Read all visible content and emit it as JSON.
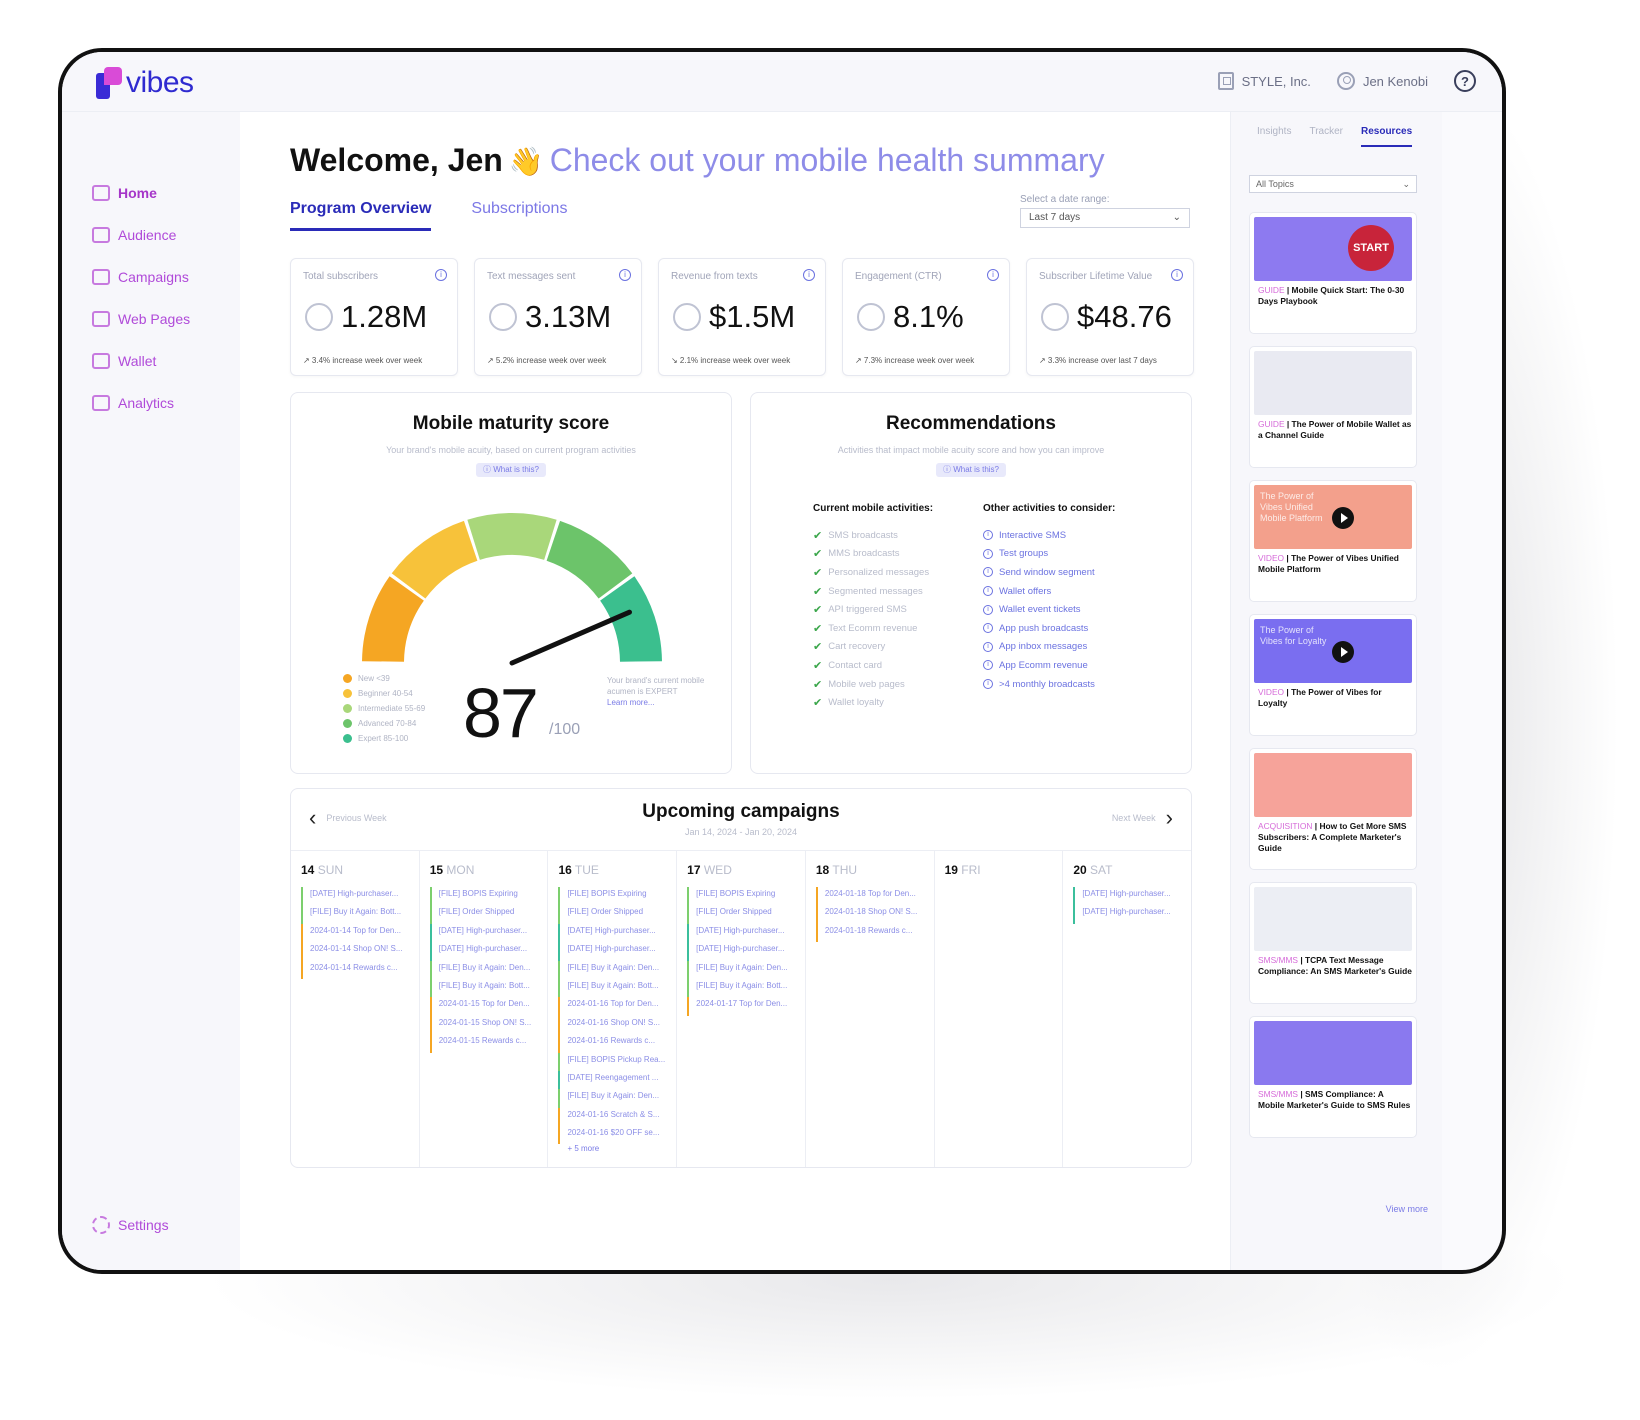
{
  "app": {
    "logo_text": "vibes",
    "brand_color": "#2f2ad0"
  },
  "topbar": {
    "company": "STYLE, Inc.",
    "user": "Jen Kenobi",
    "help_icon": "?"
  },
  "sidebar": {
    "items": [
      {
        "label": "Home",
        "icon": "home-icon"
      },
      {
        "label": "Audience",
        "icon": "audience-icon"
      },
      {
        "label": "Campaigns",
        "icon": "campaigns-icon"
      },
      {
        "label": "Web Pages",
        "icon": "web-pages-icon"
      },
      {
        "label": "Wallet",
        "icon": "wallet-icon"
      },
      {
        "label": "Analytics",
        "icon": "analytics-icon"
      }
    ],
    "settings": "Settings"
  },
  "main": {
    "welcome": "Welcome, Jen",
    "wave": "👋",
    "subtitle": "Check out your mobile health summary",
    "tabs": [
      {
        "label": "Program Overview"
      },
      {
        "label": "Subscriptions"
      }
    ],
    "date_range": {
      "label": "Select a date range:",
      "value": "Last 7 days"
    }
  },
  "stats": [
    {
      "label": "Total subscribers",
      "value": "1.28M",
      "delta": "↗ 3.4% increase week over week"
    },
    {
      "label": "Text messages sent",
      "value": "3.13M",
      "delta": "↗ 5.2% increase week over week"
    },
    {
      "label": "Revenue from texts",
      "value": "$1.5M",
      "delta": "↘ 2.1% increase week over week"
    },
    {
      "label": "Engagement (CTR)",
      "value": "8.1%",
      "delta": "↗ 7.3% increase week over week"
    },
    {
      "label": "Subscriber Lifetime Value",
      "value": "$48.76",
      "delta": "↗ 3.3% increase over last 7 days"
    }
  ],
  "maturity": {
    "title": "Mobile maturity score",
    "subtitle": "Your brand's mobile acuity, based on current program activities",
    "pill": "ⓘ What is this?",
    "score": "87",
    "max": "/100",
    "score_value": 87,
    "note": "Your brand's current mobile acumen is EXPERT",
    "learn_more": "Learn more...",
    "legend": [
      {
        "label": "New <39",
        "color": "#f5a623"
      },
      {
        "label": "Beginner 40-54",
        "color": "#f7c23a"
      },
      {
        "label": "Intermediate 55-69",
        "color": "#a9d77a"
      },
      {
        "label": "Advanced 70-84",
        "color": "#6cc46a"
      },
      {
        "label": "Expert 85-100",
        "color": "#3bbf8e"
      }
    ]
  },
  "recommendations": {
    "title": "Recommendations",
    "subtitle": "Activities that impact mobile acuity score and how you can improve",
    "pill": "ⓘ What is this?",
    "current_title": "Current mobile activities:",
    "current": [
      "SMS broadcasts",
      "MMS broadcasts",
      "Personalized messages",
      "Segmented messages",
      "API triggered SMS",
      "Text Ecomm revenue",
      "Cart recovery",
      "Contact card",
      "Mobile web pages",
      "Wallet loyalty"
    ],
    "other_title": "Other activities to consider:",
    "other": [
      "Interactive SMS",
      "Test groups",
      "Send window segment",
      "Wallet offers",
      "Wallet event tickets",
      "App push broadcasts",
      "App inbox messages",
      "App Ecomm revenue",
      ">4 monthly broadcasts"
    ]
  },
  "calendar": {
    "title": "Upcoming campaigns",
    "range": "Jan 14, 2024 - Jan 20, 2024",
    "prev": "Previous Week",
    "next": "Next Week",
    "days": [
      {
        "num": "14",
        "name": "SUN",
        "events": [
          {
            "t": "[DATE] High-purchaser...",
            "c": "g"
          },
          {
            "t": "[FILE] Buy it Again: Bott...",
            "c": "g"
          },
          {
            "t": "2024-01-14 Top for Den...",
            "c": "o"
          },
          {
            "t": "2024-01-14 Shop ON! S...",
            "c": "o"
          },
          {
            "t": "2024-01-14 Rewards c...",
            "c": "o"
          }
        ]
      },
      {
        "num": "15",
        "name": "MON",
        "events": [
          {
            "t": "[FILE] BOPIS Expiring",
            "c": "g"
          },
          {
            "t": "[FILE] Order Shipped",
            "c": "g"
          },
          {
            "t": "[DATE] High-purchaser...",
            "c": "t"
          },
          {
            "t": "[DATE] High-purchaser...",
            "c": "t"
          },
          {
            "t": "[FILE] Buy it Again: Den...",
            "c": "g"
          },
          {
            "t": "[FILE] Buy it Again: Bott...",
            "c": "g"
          },
          {
            "t": "2024-01-15 Top for Den...",
            "c": "o"
          },
          {
            "t": "2024-01-15 Shop ON! S...",
            "c": "o"
          },
          {
            "t": "2024-01-15 Rewards c...",
            "c": "o"
          }
        ]
      },
      {
        "num": "16",
        "name": "TUE",
        "events": [
          {
            "t": "[FILE] BOPIS Expiring",
            "c": "g"
          },
          {
            "t": "[FILE] Order Shipped",
            "c": "g"
          },
          {
            "t": "[DATE] High-purchaser...",
            "c": "t"
          },
          {
            "t": "[DATE] High-purchaser...",
            "c": "t"
          },
          {
            "t": "[FILE] Buy it Again: Den...",
            "c": "g"
          },
          {
            "t": "[FILE] Buy it Again: Bott...",
            "c": "g"
          },
          {
            "t": "2024-01-16 Top for Den...",
            "c": "o"
          },
          {
            "t": "2024-01-16 Shop ON! S...",
            "c": "o"
          },
          {
            "t": "2024-01-16 Rewards c...",
            "c": "o"
          },
          {
            "t": "[FILE] BOPIS Pickup Rea...",
            "c": "g"
          },
          {
            "t": "[DATE] Reengagement ...",
            "c": "t"
          },
          {
            "t": "[FILE] Buy it Again: Den...",
            "c": "g"
          },
          {
            "t": "2024-01-16 Scratch & S...",
            "c": "o"
          },
          {
            "t": "2024-01-16 $20 OFF se...",
            "c": "o"
          }
        ],
        "more": "+ 5 more"
      },
      {
        "num": "17",
        "name": "WED",
        "events": [
          {
            "t": "[FILE] BOPIS Expiring",
            "c": "g"
          },
          {
            "t": "[FILE] Order Shipped",
            "c": "g"
          },
          {
            "t": "[DATE] High-purchaser...",
            "c": "t"
          },
          {
            "t": "[DATE] High-purchaser...",
            "c": "t"
          },
          {
            "t": "[FILE] Buy it Again: Den...",
            "c": "g"
          },
          {
            "t": "[FILE] Buy it Again: Bott...",
            "c": "g"
          },
          {
            "t": "2024-01-17 Top for Den...",
            "c": "o"
          }
        ]
      },
      {
        "num": "18",
        "name": "THU",
        "events": [
          {
            "t": "2024-01-18 Top for Den...",
            "c": "o"
          },
          {
            "t": "2024-01-18 Shop ON! S...",
            "c": "o"
          },
          {
            "t": "2024-01-18 Rewards c...",
            "c": "o"
          }
        ]
      },
      {
        "num": "19",
        "name": "FRI",
        "events": []
      },
      {
        "num": "20",
        "name": "SAT",
        "events": [
          {
            "t": "[DATE] High-purchaser...",
            "c": "t"
          },
          {
            "t": "[DATE] High-purchaser...",
            "c": "t"
          }
        ]
      }
    ]
  },
  "resources": {
    "tabs": [
      "Insights",
      "Tracker",
      "Resources"
    ],
    "filter": "All Topics",
    "cards": [
      {
        "kind": "GUIDE",
        "title": "Mobile Quick Start: The 0-30 Days Playbook",
        "bg": "#8d7af0",
        "badge": "START"
      },
      {
        "kind": "GUIDE",
        "title": "The Power of Mobile Wallet as a Channel Guide",
        "bg": "#e9eaf2"
      },
      {
        "kind": "VIDEO",
        "title": "The Power of Vibes Unified Mobile Platform",
        "bg": "#f3a08c",
        "overlay": "The Power of Vibes Unified Mobile Platform"
      },
      {
        "kind": "VIDEO",
        "title": "The Power of Vibes for Loyalty",
        "bg": "#7a6ef0",
        "overlay": "The Power of Vibes for Loyalty"
      },
      {
        "kind": "ACQUISITION",
        "title": "How to Get More SMS Subscribers: A Complete Marketer's Guide",
        "bg": "#f6a39a"
      },
      {
        "kind": "SMS/MMS",
        "title": "TCPA Text Message Compliance: An SMS Marketer's Guide",
        "bg": "#eceef4"
      },
      {
        "kind": "SMS/MMS",
        "title": "SMS Compliance: A Mobile Marketer's Guide to SMS Rules",
        "bg": "#8a79ef"
      }
    ],
    "view_more": "View more"
  }
}
